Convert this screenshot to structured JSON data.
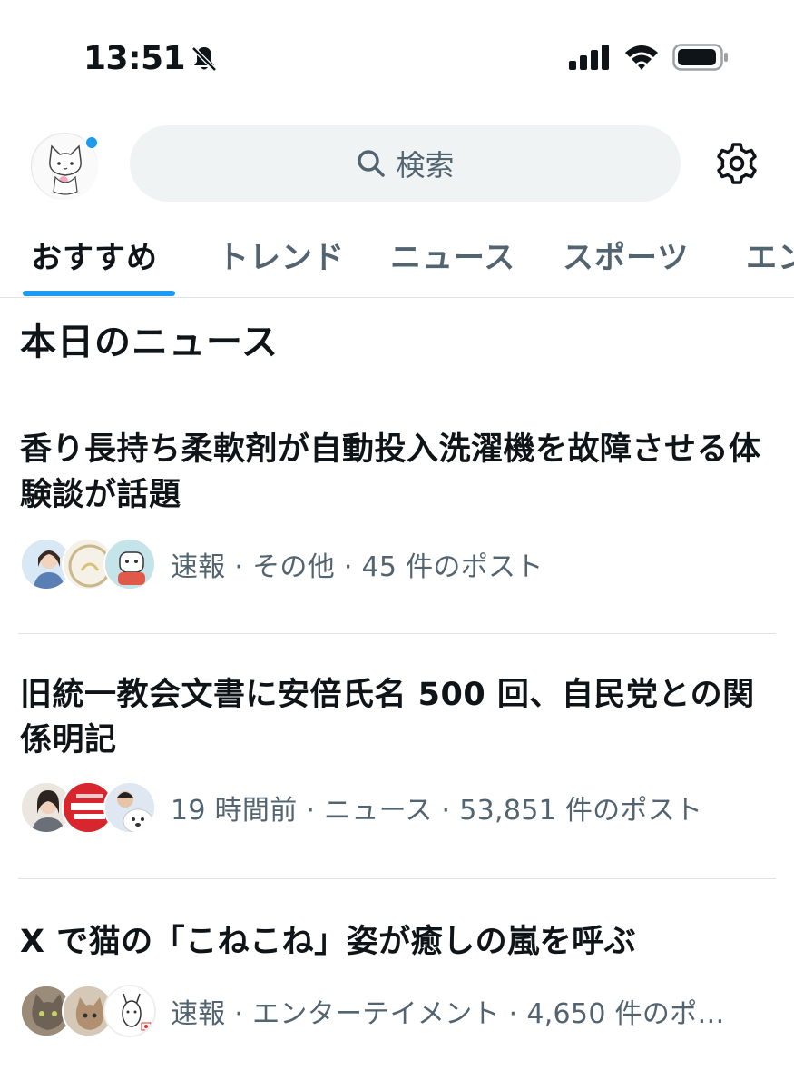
{
  "status_bar": {
    "time": "13:51"
  },
  "header": {
    "search_placeholder": "検索"
  },
  "tabs": [
    {
      "label": "おすすめ",
      "active": true
    },
    {
      "label": "トレンド",
      "active": false
    },
    {
      "label": "ニュース",
      "active": false
    },
    {
      "label": "スポーツ",
      "active": false
    },
    {
      "label": "エン",
      "active": false
    }
  ],
  "section": {
    "title": "本日のニュース"
  },
  "news": [
    {
      "headline": "香り長持ち柔軟剤が自動投入洗濯機を故障させる体験談が話題",
      "meta": "速報 · その他 · 45 件のポスト"
    },
    {
      "headline": "旧統一教会文書に安倍氏名 500 回、自民党との関係明記",
      "meta": "19 時間前 · ニュース · 53,851 件のポスト"
    },
    {
      "headline": "X で猫の「こねこね」姿が癒しの嵐を呼ぶ",
      "meta": "速報 · エンターテイメント · 4,650 件のポ…"
    }
  ],
  "colors": {
    "accent": "#1d9bf0",
    "text_primary": "#0f1419",
    "text_secondary": "#536471",
    "search_bg": "#eff3f4",
    "divider": "#dfe3e6"
  }
}
